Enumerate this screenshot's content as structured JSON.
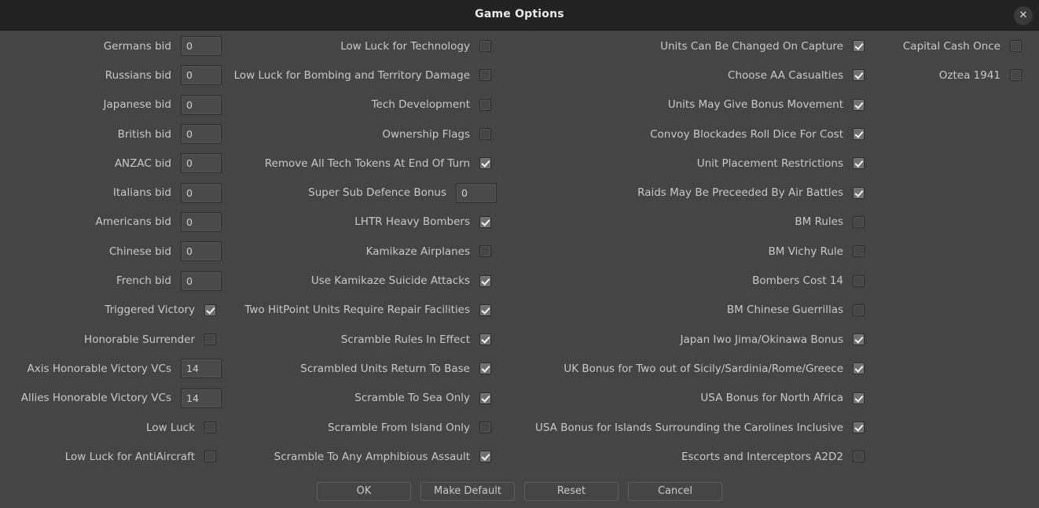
{
  "window": {
    "title": "Game Options",
    "close_label": "✕"
  },
  "columns": {
    "left": [
      {
        "label": "Germans bid",
        "type": "text",
        "value": "0"
      },
      {
        "label": "Russians bid",
        "type": "text",
        "value": "0"
      },
      {
        "label": "Japanese bid",
        "type": "text",
        "value": "0"
      },
      {
        "label": "British bid",
        "type": "text",
        "value": "0"
      },
      {
        "label": "ANZAC bid",
        "type": "text",
        "value": "0"
      },
      {
        "label": "Italians bid",
        "type": "text",
        "value": "0"
      },
      {
        "label": "Americans bid",
        "type": "text",
        "value": "0"
      },
      {
        "label": "Chinese bid",
        "type": "text",
        "value": "0"
      },
      {
        "label": "French bid",
        "type": "text",
        "value": "0"
      },
      {
        "label": "Triggered Victory",
        "type": "checkbox",
        "checked": true
      },
      {
        "label": "Honorable Surrender",
        "type": "checkbox",
        "checked": false
      },
      {
        "label": "Axis Honorable Victory VCs",
        "type": "text",
        "value": "14"
      },
      {
        "label": "Allies Honorable Victory VCs",
        "type": "text",
        "value": "14"
      },
      {
        "label": "Low Luck",
        "type": "checkbox",
        "checked": false
      },
      {
        "label": "Low Luck for AntiAircraft",
        "type": "checkbox",
        "checked": false
      }
    ],
    "middle": [
      {
        "label": "Low Luck for Technology",
        "type": "checkbox",
        "checked": false
      },
      {
        "label": "Low Luck for Bombing and Territory Damage",
        "type": "checkbox",
        "checked": false
      },
      {
        "label": "Tech Development",
        "type": "checkbox",
        "checked": false
      },
      {
        "label": "Ownership Flags",
        "type": "checkbox",
        "checked": false
      },
      {
        "label": "Remove All Tech Tokens At End Of Turn",
        "type": "checkbox",
        "checked": true
      },
      {
        "label": "Super Sub Defence Bonus",
        "type": "text",
        "value": "0"
      },
      {
        "label": "LHTR Heavy Bombers",
        "type": "checkbox",
        "checked": true
      },
      {
        "label": "Kamikaze Airplanes",
        "type": "checkbox",
        "checked": false
      },
      {
        "label": "Use Kamikaze Suicide Attacks",
        "type": "checkbox",
        "checked": true
      },
      {
        "label": "Two HitPoint Units Require Repair Facilities",
        "type": "checkbox",
        "checked": true
      },
      {
        "label": "Scramble Rules In Effect",
        "type": "checkbox",
        "checked": true
      },
      {
        "label": "Scrambled Units Return To Base",
        "type": "checkbox",
        "checked": true
      },
      {
        "label": "Scramble To Sea Only",
        "type": "checkbox",
        "checked": true
      },
      {
        "label": "Scramble From Island Only",
        "type": "checkbox",
        "checked": false
      },
      {
        "label": "Scramble To Any Amphibious Assault",
        "type": "checkbox",
        "checked": true
      }
    ],
    "right": [
      {
        "label": "Units Can Be Changed On Capture",
        "type": "checkbox",
        "checked": true
      },
      {
        "label": "Choose AA Casualties",
        "type": "checkbox",
        "checked": true
      },
      {
        "label": "Units May Give Bonus Movement",
        "type": "checkbox",
        "checked": true
      },
      {
        "label": "Convoy Blockades Roll Dice For Cost",
        "type": "checkbox",
        "checked": true
      },
      {
        "label": "Unit Placement Restrictions",
        "type": "checkbox",
        "checked": true
      },
      {
        "label": "Raids May Be Preceeded By Air Battles",
        "type": "checkbox",
        "checked": true
      },
      {
        "label": "BM Rules",
        "type": "checkbox",
        "checked": false
      },
      {
        "label": "BM Vichy Rule",
        "type": "checkbox",
        "checked": false
      },
      {
        "label": "Bombers Cost 14",
        "type": "checkbox",
        "checked": false
      },
      {
        "label": "BM Chinese Guerrillas",
        "type": "checkbox",
        "checked": false
      },
      {
        "label": "Japan Iwo Jima/Okinawa Bonus",
        "type": "checkbox",
        "checked": true
      },
      {
        "label": "UK Bonus for Two out of Sicily/Sardinia/Rome/Greece",
        "type": "checkbox",
        "checked": true
      },
      {
        "label": "USA Bonus for North Africa",
        "type": "checkbox",
        "checked": true
      },
      {
        "label": "USA Bonus for Islands Surrounding the Carolines Inclusive",
        "type": "checkbox",
        "checked": true
      },
      {
        "label": "Escorts and Interceptors A2D2",
        "type": "checkbox",
        "checked": false
      }
    ],
    "far_right": [
      {
        "label": "Capital Cash Once",
        "type": "checkbox",
        "checked": false
      },
      {
        "label": "Oztea 1941",
        "type": "checkbox",
        "checked": false
      }
    ]
  },
  "buttons": [
    {
      "label": "OK"
    },
    {
      "label": "Make Default"
    },
    {
      "label": "Reset"
    },
    {
      "label": "Cancel"
    }
  ],
  "colors": {
    "window_background": "#454545",
    "titlebar_background": "#232323",
    "label_text": "#c8c8c8",
    "title_text": "#e8e8e8",
    "checkbox_checked": "#6e6e6e"
  }
}
